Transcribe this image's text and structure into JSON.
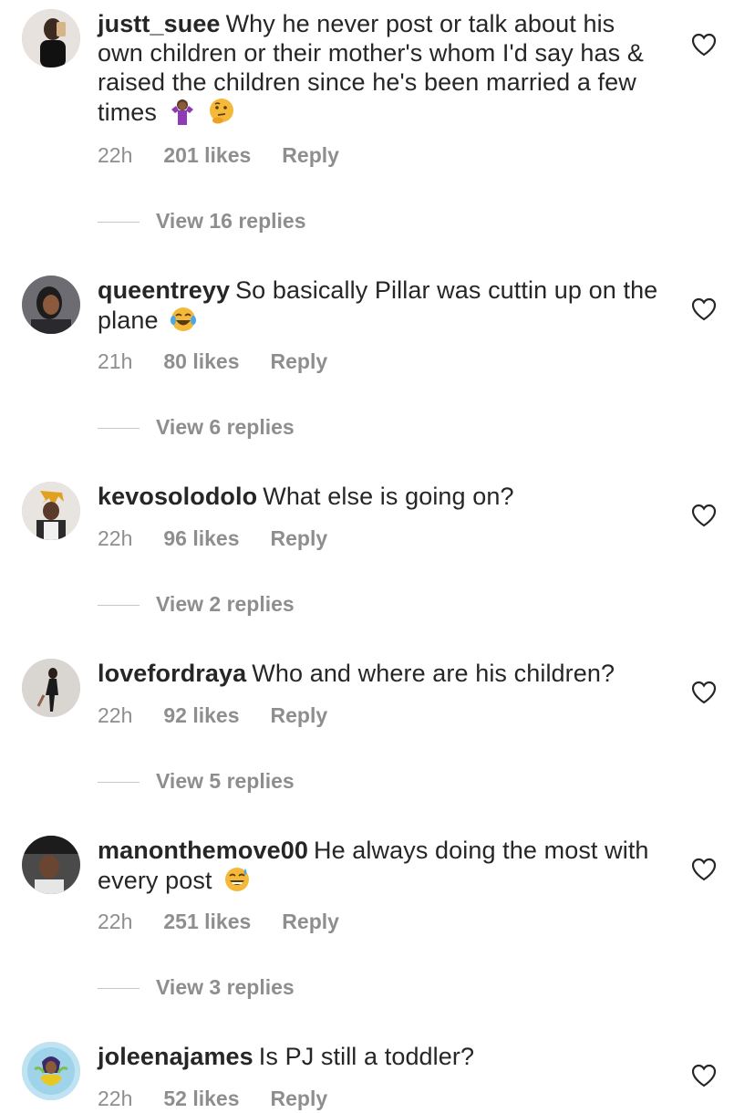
{
  "comments": [
    {
      "username": "justt_suee",
      "text": "Why he never post or talk about his own children or their mother's whom I'd say has & raised the children since he's been married a few times",
      "emojis": [
        "person-shrugging",
        "thinking-face"
      ],
      "time": "22h",
      "likes": "201 likes",
      "reply": "Reply",
      "view_replies": "View 16 replies"
    },
    {
      "username": "queentreyy",
      "text": "So basically Pillar was cuttin up on the plane",
      "emojis": [
        "face-with-tears-of-joy"
      ],
      "time": "21h",
      "likes": "80 likes",
      "reply": "Reply",
      "view_replies": "View 6 replies"
    },
    {
      "username": "kevosolodolo",
      "text": "What else is going on?",
      "emojis": [],
      "time": "22h",
      "likes": "96 likes",
      "reply": "Reply",
      "view_replies": "View 2 replies"
    },
    {
      "username": "lovefordraya",
      "text": "Who and where are his children?",
      "emojis": [],
      "time": "22h",
      "likes": "92 likes",
      "reply": "Reply",
      "view_replies": "View 5 replies"
    },
    {
      "username": "manonthemove00",
      "text": "He always doing the most with every post",
      "emojis": [
        "grinning-face-with-sweat"
      ],
      "time": "22h",
      "likes": "251 likes",
      "reply": "Reply",
      "view_replies": "View 3 replies"
    },
    {
      "username": "joleenajames",
      "text": "Is PJ still a toddler?",
      "emojis": [],
      "time": "22h",
      "likes": "52 likes",
      "reply": "Reply"
    }
  ],
  "icons": {
    "like": "heart-outline-icon"
  },
  "colors": {
    "text": "#262626",
    "secondary": "#8e8e8e",
    "divider": "#c7c7c7"
  }
}
